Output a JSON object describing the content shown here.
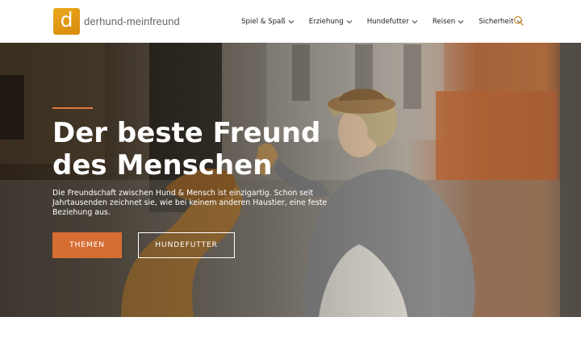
{
  "header": {
    "logo_letter": "d",
    "logo_text": "derhund-meinfreund",
    "brand_color": "#e39a17",
    "nav": [
      {
        "label": "Spiel & Spaß",
        "icon": "chevron-down-icon"
      },
      {
        "label": "Erziehung",
        "icon": "chevron-down-icon"
      },
      {
        "label": "Hundefutter",
        "icon": "chevron-down-icon"
      },
      {
        "label": "Reisen",
        "icon": "chevron-down-icon"
      },
      {
        "label": "Sicherheit",
        "icon": "chevron-down-icon"
      }
    ],
    "search_icon": "search-icon"
  },
  "hero": {
    "title_line1": "Der beste Freund",
    "title_line2": "des Menschen",
    "text": "Die Freundschaft zwischen Hund & Mensch ist einzigartig. Schon seit Jahrtausenden zeichnet sie, wie bei keinem anderen Haustier, eine feste Beziehung aus.",
    "primary_button": "THEMEN",
    "secondary_button": "HUNDEFUTTER",
    "accent_color": "#d66d33"
  }
}
